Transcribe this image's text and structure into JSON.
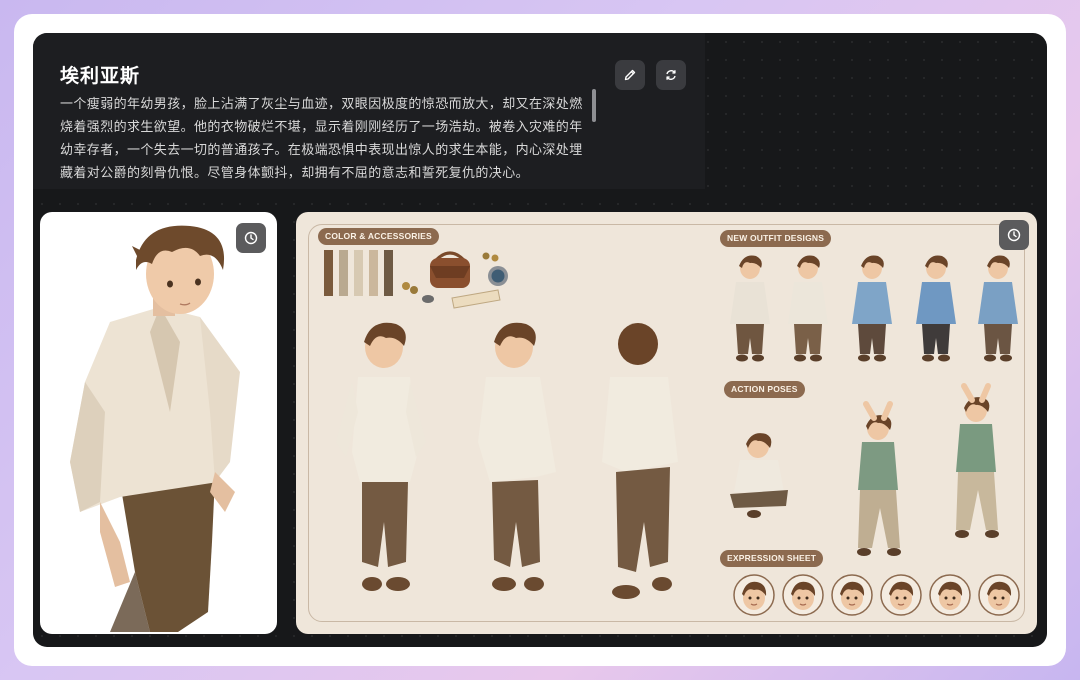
{
  "character": {
    "name": "埃利亚斯",
    "description": "一个瘦弱的年幼男孩，脸上沾满了灰尘与血迹，双眼因极度的惊恐而放大，却又在深处燃烧着强烈的求生欲望。他的衣物破烂不堪，显示着刚刚经历了一场浩劫。被卷入灾难的年幼幸存者，一个失去一切的普通孩子。在极端恐惧中表现出惊人的求生本能，内心深处埋藏着对公爵的刻骨仇恨。尽管身体颤抖，却拥有不屈的意志和誓死复仇的决心。"
  },
  "header": {
    "edit_icon": "pencil-icon",
    "regenerate_icon": "refresh-icon"
  },
  "sheet": {
    "labels": {
      "color_accessories": "COLOR & ACCESSORIES",
      "new_outfit": "NEW OUTFIT DESIGNS",
      "action_poses": "ACTION POSES",
      "expression_sheet": "EXPRESSION SHEET"
    },
    "swatches": [
      "#7a5a3c",
      "#b9a990",
      "#d7c9b2",
      "#cbb79c",
      "#6e5a44"
    ],
    "outfits": [
      {
        "shirt": "#e9e2d6",
        "pants": "#6f5640"
      },
      {
        "shirt": "#ece6da",
        "pants": "#7a6048"
      },
      {
        "shirt": "#7fa5c8",
        "pants": "#5e4a3c"
      },
      {
        "shirt": "#6f98c2",
        "pants": "#3f3b3a"
      },
      {
        "shirt": "#7aa0c4",
        "pants": "#6b5543"
      }
    ],
    "poses": [
      {
        "shirt": "#efe9de",
        "pants": "#6e5a44"
      },
      {
        "shirt": "#7d9a82",
        "pants": "#bfae92"
      },
      {
        "shirt": "#7a9a80",
        "pants": "#c8b89c"
      }
    ],
    "expressions_count": 6
  },
  "icons": {
    "clock_left": "clock-icon",
    "clock_right": "clock-icon"
  },
  "colors": {
    "app_bg": "#17181a",
    "header_bg": "#1d1e21",
    "sheet_bg": "#efe6da",
    "tag_bg": "#8c6a4f"
  }
}
